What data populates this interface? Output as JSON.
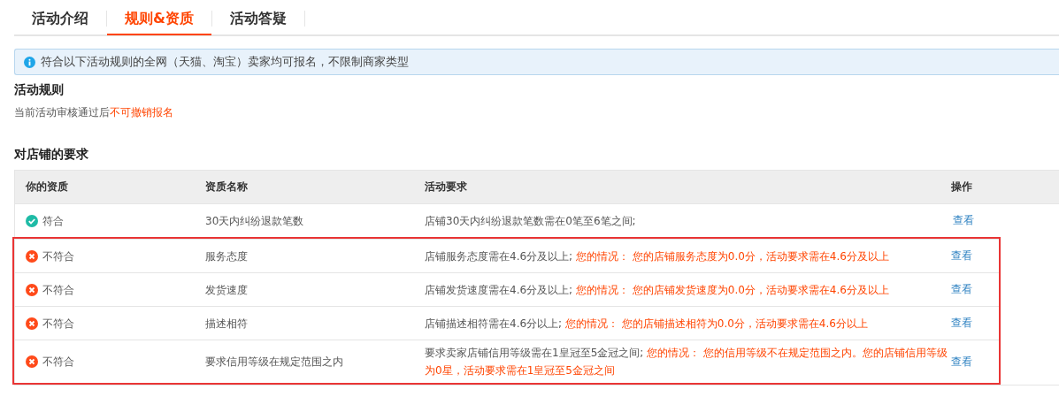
{
  "tabs": [
    {
      "label": "活动介绍",
      "selected": false
    },
    {
      "label": "规则&资质",
      "selected": true
    },
    {
      "label": "活动答疑",
      "selected": false
    }
  ],
  "notice": "符合以下活动规则的全网（天猫、淘宝）卖家均可报名，不限制商家类型",
  "rules": {
    "title": "活动规则",
    "text": "当前活动审核通过后",
    "highlight": "不可撤销报名"
  },
  "requirements": {
    "title": "对店铺的要求",
    "columns": [
      "你的资质",
      "资质名称",
      "活动要求",
      "操作"
    ],
    "rows": [
      {
        "status": "符合",
        "passed": true,
        "highlighted": false,
        "name": "30天内纠纷退款笔数",
        "requirement": "店铺30天内纠纷退款笔数需在0笔至6笔之间;",
        "situation": "",
        "action": "查看"
      },
      {
        "status": "不符合",
        "passed": false,
        "highlighted": true,
        "name": "服务态度",
        "requirement": "店铺服务态度需在4.6分及以上;",
        "situation": "您的情况： 您的店铺服务态度为0.0分，活动要求需在4.6分及以上",
        "action": "查看"
      },
      {
        "status": "不符合",
        "passed": false,
        "highlighted": true,
        "name": "发货速度",
        "requirement": "店铺发货速度需在4.6分及以上;",
        "situation": "您的情况： 您的店铺发货速度为0.0分，活动要求需在4.6分及以上",
        "action": "查看"
      },
      {
        "status": "不符合",
        "passed": false,
        "highlighted": true,
        "name": "描述相符",
        "requirement": "店铺描述相符需在4.6分以上;",
        "situation": "您的情况： 您的店铺描述相符为0.0分，活动要求需在4.6分以上",
        "action": "查看"
      },
      {
        "status": "不符合",
        "passed": false,
        "highlighted": true,
        "name": "要求信用等级在规定范围之内",
        "requirement": "要求卖家店铺信用等级需在1皇冠至5金冠之间;",
        "situation": "您的情况： 您的信用等级不在规定范围之内。您的店铺信用等级为0星，活动要求需在1皇冠至5金冠之间",
        "action": "查看"
      }
    ]
  }
}
